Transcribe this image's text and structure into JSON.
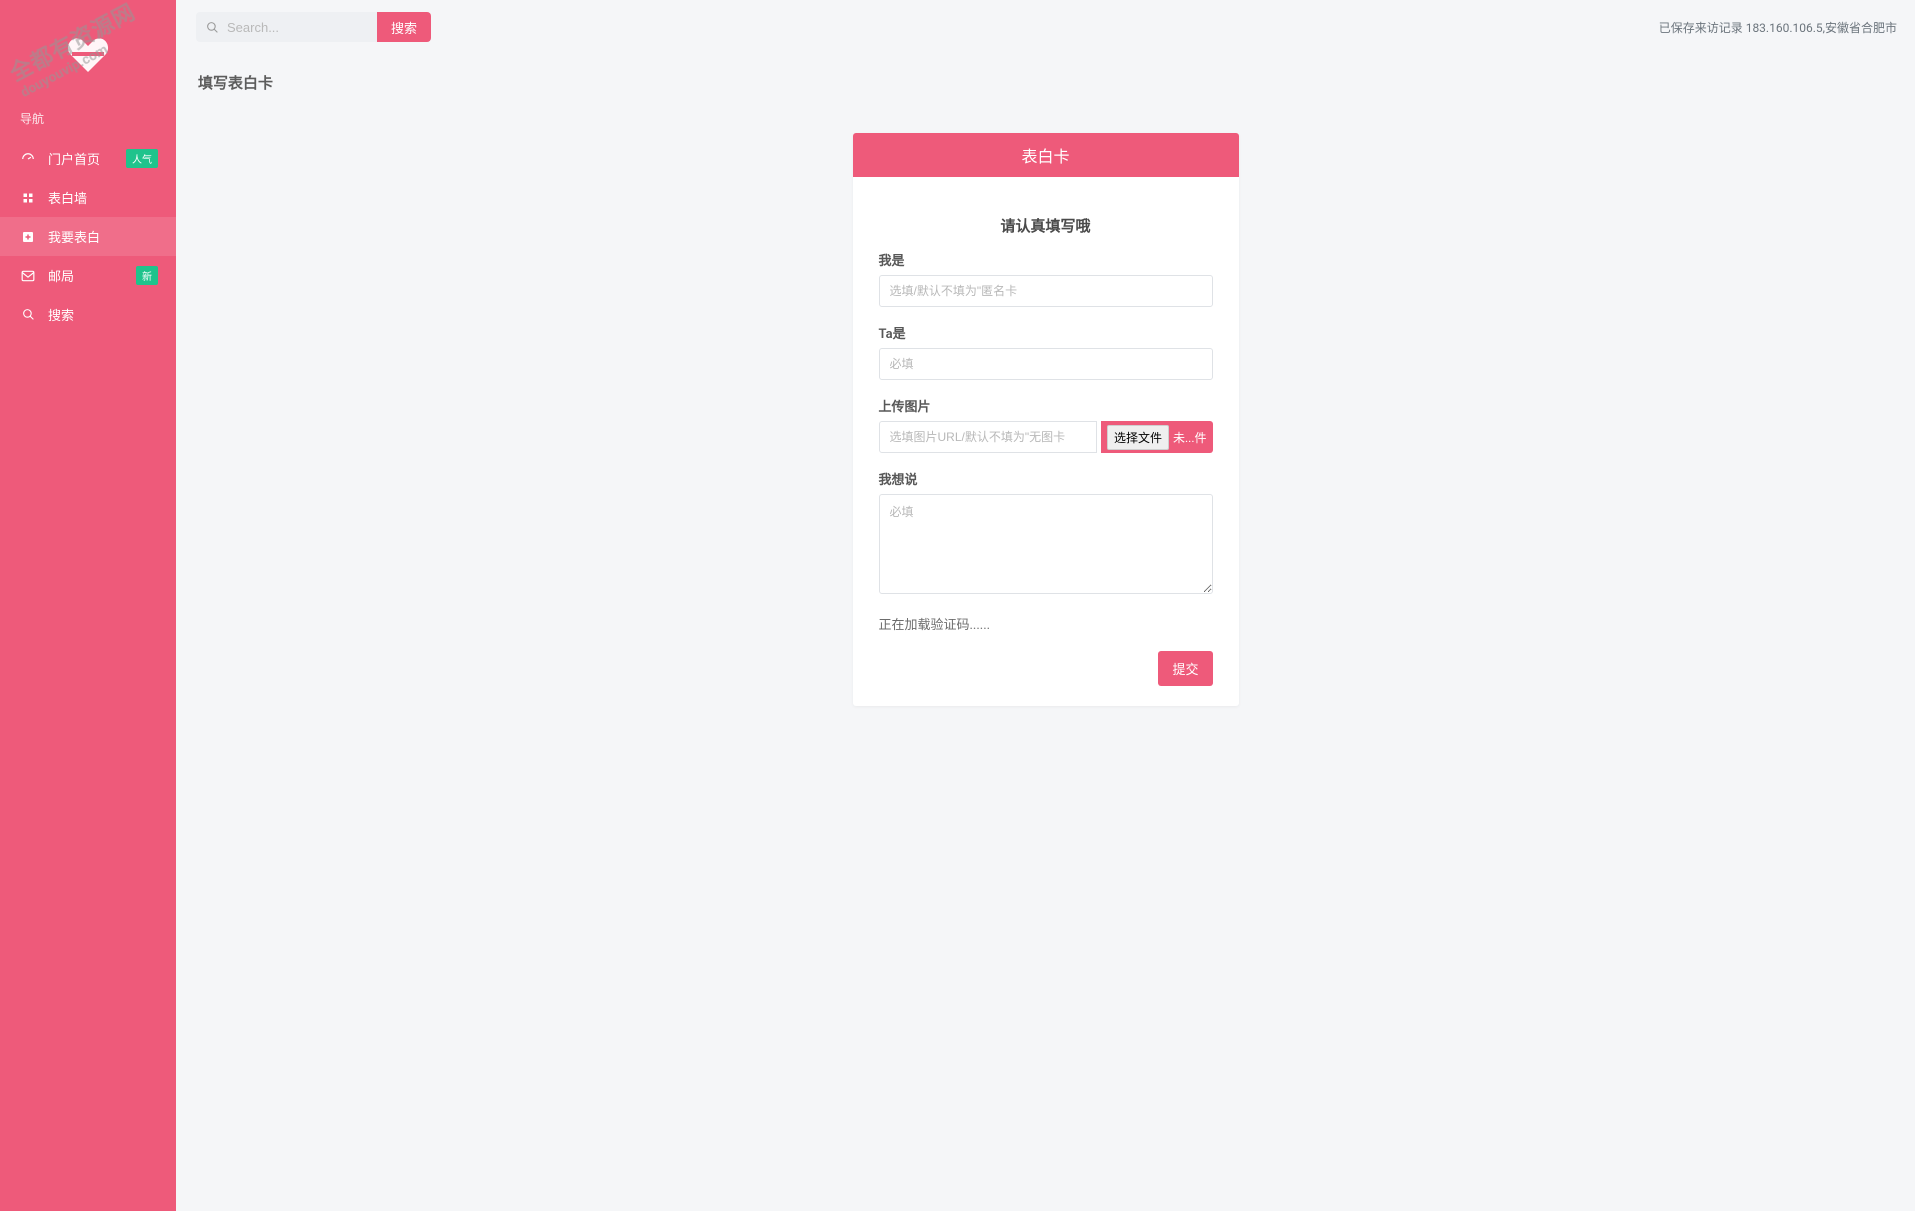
{
  "watermark": {
    "line1": "全都有资源网",
    "line2": "douyouvip.com"
  },
  "sidebar": {
    "section": "导航",
    "items": [
      {
        "name": "home",
        "label": "门户首页",
        "badge": "人气"
      },
      {
        "name": "wall",
        "label": "表白墙",
        "badge": ""
      },
      {
        "name": "confess",
        "label": "我要表白",
        "badge": ""
      },
      {
        "name": "post",
        "label": "邮局",
        "badge": "新"
      },
      {
        "name": "search",
        "label": "搜索",
        "badge": ""
      }
    ]
  },
  "topbar": {
    "search_placeholder": "Search...",
    "search_button": "搜索",
    "visit_record": "已保存来访记录 183.160.106.5,安徽省合肥市"
  },
  "page": {
    "title": "填写表白卡"
  },
  "card": {
    "header": "表白卡",
    "form_title": "请认真填写哦",
    "label_from": "我是",
    "placeholder_from": "选填/默认不填为\"匿名卡",
    "label_to": "Ta是",
    "placeholder_to": "必填",
    "label_upload": "上传图片",
    "placeholder_upload": "选填图片URL/默认不填为\"无图卡",
    "file_button": "选择文件",
    "file_status": "未...件",
    "label_msg": "我想说",
    "placeholder_msg": "必填",
    "captcha": "正在加载验证码......",
    "submit": "提交"
  }
}
